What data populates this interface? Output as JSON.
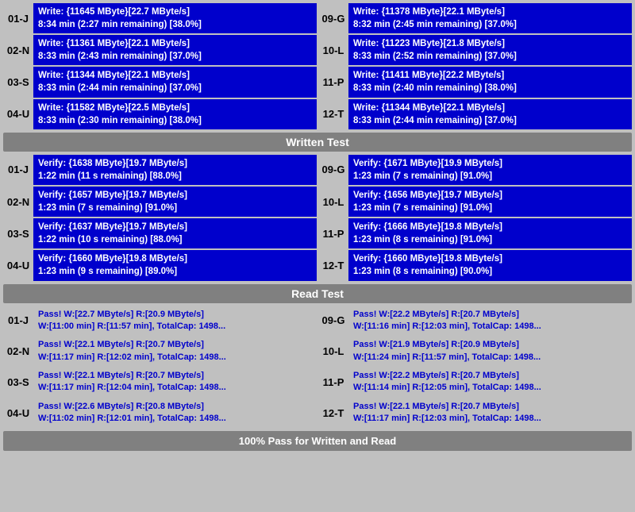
{
  "sections": {
    "written_test": {
      "label": "Written Test",
      "rows": [
        {
          "left": {
            "id": "01-J",
            "line1": "Write: {11645 MByte}[22.7 MByte/s]",
            "line2": "8:34 min (2:27 min remaining)  [38.0%]"
          },
          "right": {
            "id": "09-G",
            "line1": "Write: {11378 MByte}[22.1 MByte/s]",
            "line2": "8:32 min (2:45 min remaining)  [37.0%]"
          }
        },
        {
          "left": {
            "id": "02-N",
            "line1": "Write: {11361 MByte}[22.1 MByte/s]",
            "line2": "8:33 min (2:43 min remaining)  [37.0%]"
          },
          "right": {
            "id": "10-L",
            "line1": "Write: {11223 MByte}[21.8 MByte/s]",
            "line2": "8:33 min (2:52 min remaining)  [37.0%]"
          }
        },
        {
          "left": {
            "id": "03-S",
            "line1": "Write: {11344 MByte}[22.1 MByte/s]",
            "line2": "8:33 min (2:44 min remaining)  [37.0%]"
          },
          "right": {
            "id": "11-P",
            "line1": "Write: {11411 MByte}[22.2 MByte/s]",
            "line2": "8:33 min (2:40 min remaining)  [38.0%]"
          }
        },
        {
          "left": {
            "id": "04-U",
            "line1": "Write: {11582 MByte}[22.5 MByte/s]",
            "line2": "8:33 min (2:30 min remaining)  [38.0%]"
          },
          "right": {
            "id": "12-T",
            "line1": "Write: {11344 MByte}[22.1 MByte/s]",
            "line2": "8:33 min (2:44 min remaining)  [37.0%]"
          }
        }
      ]
    },
    "verify_section": {
      "label": "Written Test",
      "rows": [
        {
          "left": {
            "id": "01-J",
            "line1": "Verify: {1638 MByte}[19.7 MByte/s]",
            "line2": "1:22 min (11 s remaining)  [88.0%]"
          },
          "right": {
            "id": "09-G",
            "line1": "Verify: {1671 MByte}[19.9 MByte/s]",
            "line2": "1:23 min (7 s remaining)  [91.0%]"
          }
        },
        {
          "left": {
            "id": "02-N",
            "line1": "Verify: {1657 MByte}[19.7 MByte/s]",
            "line2": "1:23 min (7 s remaining)  [91.0%]"
          },
          "right": {
            "id": "10-L",
            "line1": "Verify: {1656 MByte}[19.7 MByte/s]",
            "line2": "1:23 min (7 s remaining)  [91.0%]"
          }
        },
        {
          "left": {
            "id": "03-S",
            "line1": "Verify: {1637 MByte}[19.7 MByte/s]",
            "line2": "1:22 min (10 s remaining)  [88.0%]"
          },
          "right": {
            "id": "11-P",
            "line1": "Verify: {1666 MByte}[19.8 MByte/s]",
            "line2": "1:23 min (8 s remaining)  [91.0%]"
          }
        },
        {
          "left": {
            "id": "04-U",
            "line1": "Verify: {1660 MByte}[19.8 MByte/s]",
            "line2": "1:23 min (9 s remaining)  [89.0%]"
          },
          "right": {
            "id": "12-T",
            "line1": "Verify: {1660 MByte}[19.8 MByte/s]",
            "line2": "1:23 min (8 s remaining)  [90.0%]"
          }
        }
      ]
    },
    "read_test": {
      "label": "Read Test",
      "rows": [
        {
          "left": {
            "id": "01-J",
            "line1": "Pass! W:[22.7 MByte/s] R:[20.9 MByte/s]",
            "line2": "W:[11:00 min] R:[11:57 min], TotalCap: 1498..."
          },
          "right": {
            "id": "09-G",
            "line1": "Pass! W:[22.2 MByte/s] R:[20.7 MByte/s]",
            "line2": "W:[11:16 min] R:[12:03 min], TotalCap: 1498..."
          }
        },
        {
          "left": {
            "id": "02-N",
            "line1": "Pass! W:[22.1 MByte/s] R:[20.7 MByte/s]",
            "line2": "W:[11:17 min] R:[12:02 min], TotalCap: 1498..."
          },
          "right": {
            "id": "10-L",
            "line1": "Pass! W:[21.9 MByte/s] R:[20.9 MByte/s]",
            "line2": "W:[11:24 min] R:[11:57 min], TotalCap: 1498..."
          }
        },
        {
          "left": {
            "id": "03-S",
            "line1": "Pass! W:[22.1 MByte/s] R:[20.7 MByte/s]",
            "line2": "W:[11:17 min] R:[12:04 min], TotalCap: 1498..."
          },
          "right": {
            "id": "11-P",
            "line1": "Pass! W:[22.2 MByte/s] R:[20.7 MByte/s]",
            "line2": "W:[11:14 min] R:[12:05 min], TotalCap: 1498..."
          }
        },
        {
          "left": {
            "id": "04-U",
            "line1": "Pass! W:[22.6 MByte/s] R:[20.8 MByte/s]",
            "line2": "W:[11:02 min] R:[12:01 min], TotalCap: 1498..."
          },
          "right": {
            "id": "12-T",
            "line1": "Pass! W:[22.1 MByte/s] R:[20.7 MByte/s]",
            "line2": "W:[11:17 min] R:[12:03 min], TotalCap: 1498..."
          }
        }
      ]
    }
  },
  "headers": {
    "written_test": "Written Test",
    "read_test": "Read Test",
    "footer": "100% Pass for Written and Read"
  }
}
